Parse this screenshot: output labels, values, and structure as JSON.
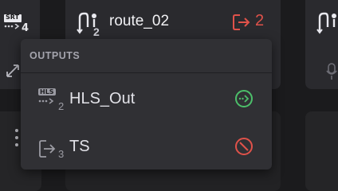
{
  "cards": {
    "left": {
      "badge": "SRT",
      "count": "4"
    },
    "main": {
      "route_name": "route_02",
      "route_index": "2",
      "output_count": "2"
    }
  },
  "dropdown": {
    "title": "OUTPUTS",
    "items": [
      {
        "label": "HLS_Out",
        "index": "2",
        "badge": "HLS",
        "status": "active",
        "status_color": "#4cbf6a",
        "icon": "output-hls-icon"
      },
      {
        "label": "TS",
        "index": "3",
        "status": "disabled",
        "status_color": "#e0524a",
        "icon": "output-exit-icon"
      }
    ]
  },
  "colors": {
    "accent_red": "#e0524a",
    "accent_green": "#4cbf6a",
    "background": "#1b1b1d",
    "panel": "#303034"
  }
}
